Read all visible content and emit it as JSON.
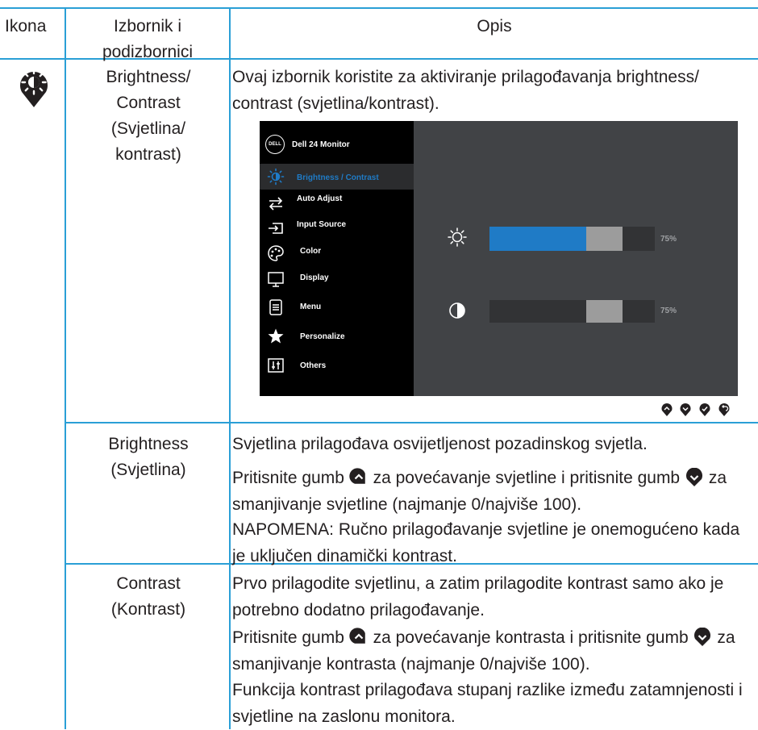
{
  "header": {
    "col_icon": "Ikona",
    "col_menu": "Izbornik i podizbornici",
    "col_desc": "Opis"
  },
  "row1": {
    "menu": "Brightness/ Contrast (Svjetlina/ kontrast)",
    "desc": "Ovaj izbornik koristite za aktiviranje prilagođavanja brightness/ contrast (svjetlina/kontrast).",
    "icon": "brightness-contrast-icon"
  },
  "osd": {
    "logo": "DELL",
    "title": "Dell 24 Monitor",
    "items": [
      {
        "label": "Brightness / Contrast",
        "icon": "sun-icon",
        "active": true
      },
      {
        "label": "Auto Adjust",
        "icon": "arrows-icon",
        "active": false
      },
      {
        "label": "Input Source",
        "icon": "input-icon",
        "active": false
      },
      {
        "label": "Color",
        "icon": "palette-icon",
        "active": false
      },
      {
        "label": "Display",
        "icon": "monitor-icon",
        "active": false
      },
      {
        "label": "Menu",
        "icon": "document-icon",
        "active": false
      },
      {
        "label": "Personalize",
        "icon": "star-icon",
        "active": false
      },
      {
        "label": "Others",
        "icon": "sliders-icon",
        "active": false
      }
    ],
    "brightness": {
      "value": 75,
      "label": "75%"
    },
    "contrast": {
      "value": 75,
      "label": "75%"
    },
    "colors": {
      "accent": "#1f7bc6",
      "panel": "#414346",
      "menu": "#000000"
    }
  },
  "row2": {
    "menu": "Brightness (Svjetlina)",
    "p1": "Svjetlina prilagođava osvijetljenost pozadinskog svjetla.",
    "p2a": "Pritisnite gumb",
    "p2b": "za povećavanje svjetline i pritisnite gumb",
    "p2c": "za smanjivanje svjetline (najmanje 0/najviše 100).",
    "note_label": "NAPOMENA:",
    "note": "Ručno prilagođavanje svjetline je onemogućeno kada je uključen dinamički kontrast."
  },
  "row3": {
    "menu": "Contrast (Kontrast)",
    "p1": "Prvo prilagodite svjetlinu, a zatim prilagodite kontrast samo ako je potrebno dodatno prilagođavanje.",
    "p2a": "Pritisnite gumb",
    "p2b": "za povećavanje kontrasta i pritisnite gumb",
    "p2c": "za smanjivanje kontrasta (najmanje 0/najviše 100).",
    "p3": "Funkcija kontrast prilagođava stupanj razlike između zatamnjenosti i svjetline na zaslonu monitora."
  }
}
